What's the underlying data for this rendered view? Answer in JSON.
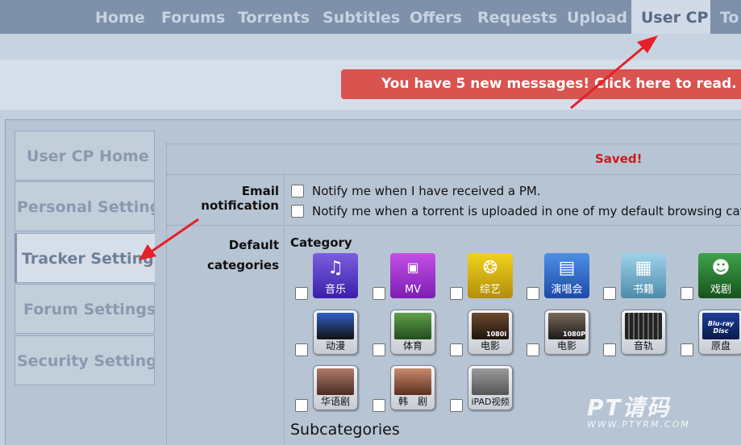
{
  "nav": {
    "tabs": [
      "Home",
      "Forums",
      "Torrents",
      "Subtitles",
      "Offers",
      "Requests",
      "Upload",
      "User CP",
      "To"
    ],
    "active": "User CP"
  },
  "message_bar": "You have 5 new messages! Click here to read.",
  "sidebar": {
    "items": [
      "User CP Home",
      "Personal Settings",
      "Tracker Settings",
      "Forum Settings",
      "Security Settings"
    ],
    "active": "Tracker Settings"
  },
  "status": "Saved!",
  "email": {
    "label": "Email notification",
    "options": [
      "Notify me when I have received a PM.",
      "Notify me when a torrent is uploaded in one of my default browsing categ"
    ]
  },
  "categories": {
    "label_line1": "Default",
    "label_line2": "categories",
    "heading": "Category",
    "items": [
      "音乐",
      "MV",
      "综艺",
      "演唱会",
      "书籍",
      "戏剧",
      "动漫",
      "体育",
      "电影",
      "电影",
      "音轨",
      "原盘",
      "华语剧",
      "韩　剧",
      "iPAD视频"
    ],
    "icon_texts": [
      "1080I",
      "1080P",
      "Blu-ray Disc"
    ]
  },
  "subcategories_heading": "Subcategories",
  "watermark": {
    "main": "PT请码",
    "sub": "WWW.PTYRM.COM"
  },
  "colors": {
    "nav": "#7e90aa",
    "message": "#d9534f",
    "saved": "#cc1b1b",
    "arrow": "#e5202a"
  }
}
